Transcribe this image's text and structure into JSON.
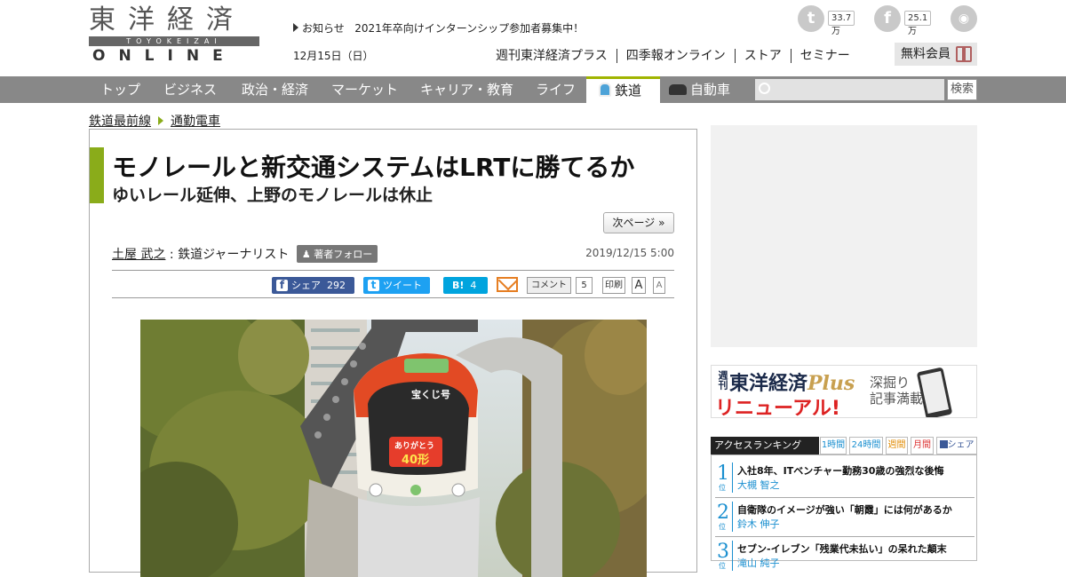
{
  "header": {
    "logo_kanji": "東洋経済",
    "logo_roman": "TOYOKEIZAI",
    "logo_online": "ONLINE",
    "news_label": "お知らせ",
    "news_text": "2021年卒向けインターンシップ参加者募集中！",
    "date": "12月15日（日）",
    "twitter_count": "33.7万",
    "facebook_count": "25.1万",
    "links": [
      "週刊東洋経済プラス",
      "四季報オンライン",
      "ストア",
      "セミナー"
    ],
    "member_label": "無料会員"
  },
  "nav": {
    "items": [
      "トップ",
      "ビジネス",
      "政治・経済",
      "マーケット",
      "キャリア・教育",
      "ライフ",
      "鉄道",
      "自動車"
    ],
    "active": "鉄道",
    "search_button": "検索",
    "search_placeholder": ""
  },
  "breadcrumb": [
    "鉄道最前線",
    "通勤電車"
  ],
  "article": {
    "title": "モノレールと新交通システムはLRTに勝てるか",
    "subtitle": "ゆいレール延伸、上野のモノレールは休止",
    "next_page": "次ページ »",
    "author": "土屋 武之",
    "author_role": ": 鉄道ジャーナリスト",
    "follow_label": "著者フォロー",
    "published": "2019/12/15 5:00",
    "share": {
      "facebook_label": "シェア",
      "facebook_count": "292",
      "tweet_label": "ツイート",
      "hatena_label": "B!",
      "hatena_count": "4",
      "comment_label": "コメント",
      "comment_count": "5",
      "print_label": "印刷",
      "font_large": "A",
      "font_small": "A"
    },
    "photo_sign_top": "宝くじ号",
    "photo_sign_main": "ありがとう",
    "photo_sign_num": "40形"
  },
  "sidebar": {
    "banner_prefix": "週刊",
    "banner_title": "東洋経済",
    "banner_plus": "Plus",
    "banner_renewal": "リニューアル!",
    "banner_tag1": "深掘り",
    "banner_tag2": "記事満載",
    "ranking_title": "アクセスランキング",
    "ranking_tabs": [
      "1時間",
      "24時間",
      "週間",
      "月間",
      "シェア"
    ],
    "ranking": [
      {
        "rank": "1",
        "pos": "位",
        "title": "入社8年、ITベンチャー勤務30歳の強烈な後悔",
        "author": "大槻 智之"
      },
      {
        "rank": "2",
        "pos": "位",
        "title": "自衛隊のイメージが強い「朝霞」には何があるか",
        "author": "鈴木 伸子"
      },
      {
        "rank": "3",
        "pos": "位",
        "title": "セブン-イレブン「残業代未払い」の呆れた顛末",
        "author": "滝山 純子"
      }
    ]
  },
  "colors": {
    "accent_green": "#8aac1a",
    "nav_gray": "#888888",
    "facebook_blue": "#3b5998",
    "twitter_blue": "#1da1f2",
    "hatena_blue": "#00a4de",
    "ranking_blue": "#1a8fd0"
  }
}
